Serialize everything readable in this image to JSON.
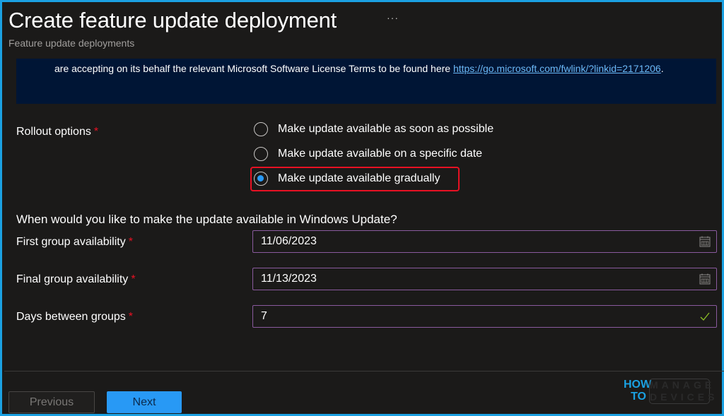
{
  "header": {
    "title": "Create feature update deployment",
    "more_label": "···",
    "subtitle": "Feature update deployments"
  },
  "notice": {
    "text": "are accepting on its behalf the relevant Microsoft Software License Terms to be found here ",
    "link_text": "https://go.microsoft.com/fwlink/?linkid=2171206",
    "trailing": "."
  },
  "rollout": {
    "label": "Rollout options",
    "required_mark": "*",
    "options": [
      {
        "label": "Make update available as soon as possible",
        "checked": false
      },
      {
        "label": "Make update available on a specific date",
        "checked": false
      },
      {
        "label": "Make update available gradually",
        "checked": true
      }
    ]
  },
  "schedule": {
    "question": "When would you like to make the update available in Windows Update?",
    "fields": [
      {
        "label": "First group availability",
        "required_mark": "*",
        "value": "11/06/2023",
        "icon": "calendar-icon"
      },
      {
        "label": "Final group availability",
        "required_mark": "*",
        "value": "11/13/2023",
        "icon": "calendar-icon"
      },
      {
        "label": "Days between groups",
        "required_mark": "*",
        "value": "7",
        "icon": "checkmark-icon"
      }
    ]
  },
  "footer": {
    "previous_label": "Previous",
    "next_label": "Next"
  },
  "watermark": {
    "line1": "HOW",
    "line2": "TO",
    "box_line1": "MANAGE",
    "box_line2": "DEVICES"
  },
  "colors": {
    "accent": "#2899f5",
    "frame": "#1ba1e2",
    "required": "#e81123",
    "field_border": "#8a5a9e",
    "notice_bg": "#001535",
    "link": "#6cb8f6",
    "valid_check": "#8cbf26"
  }
}
